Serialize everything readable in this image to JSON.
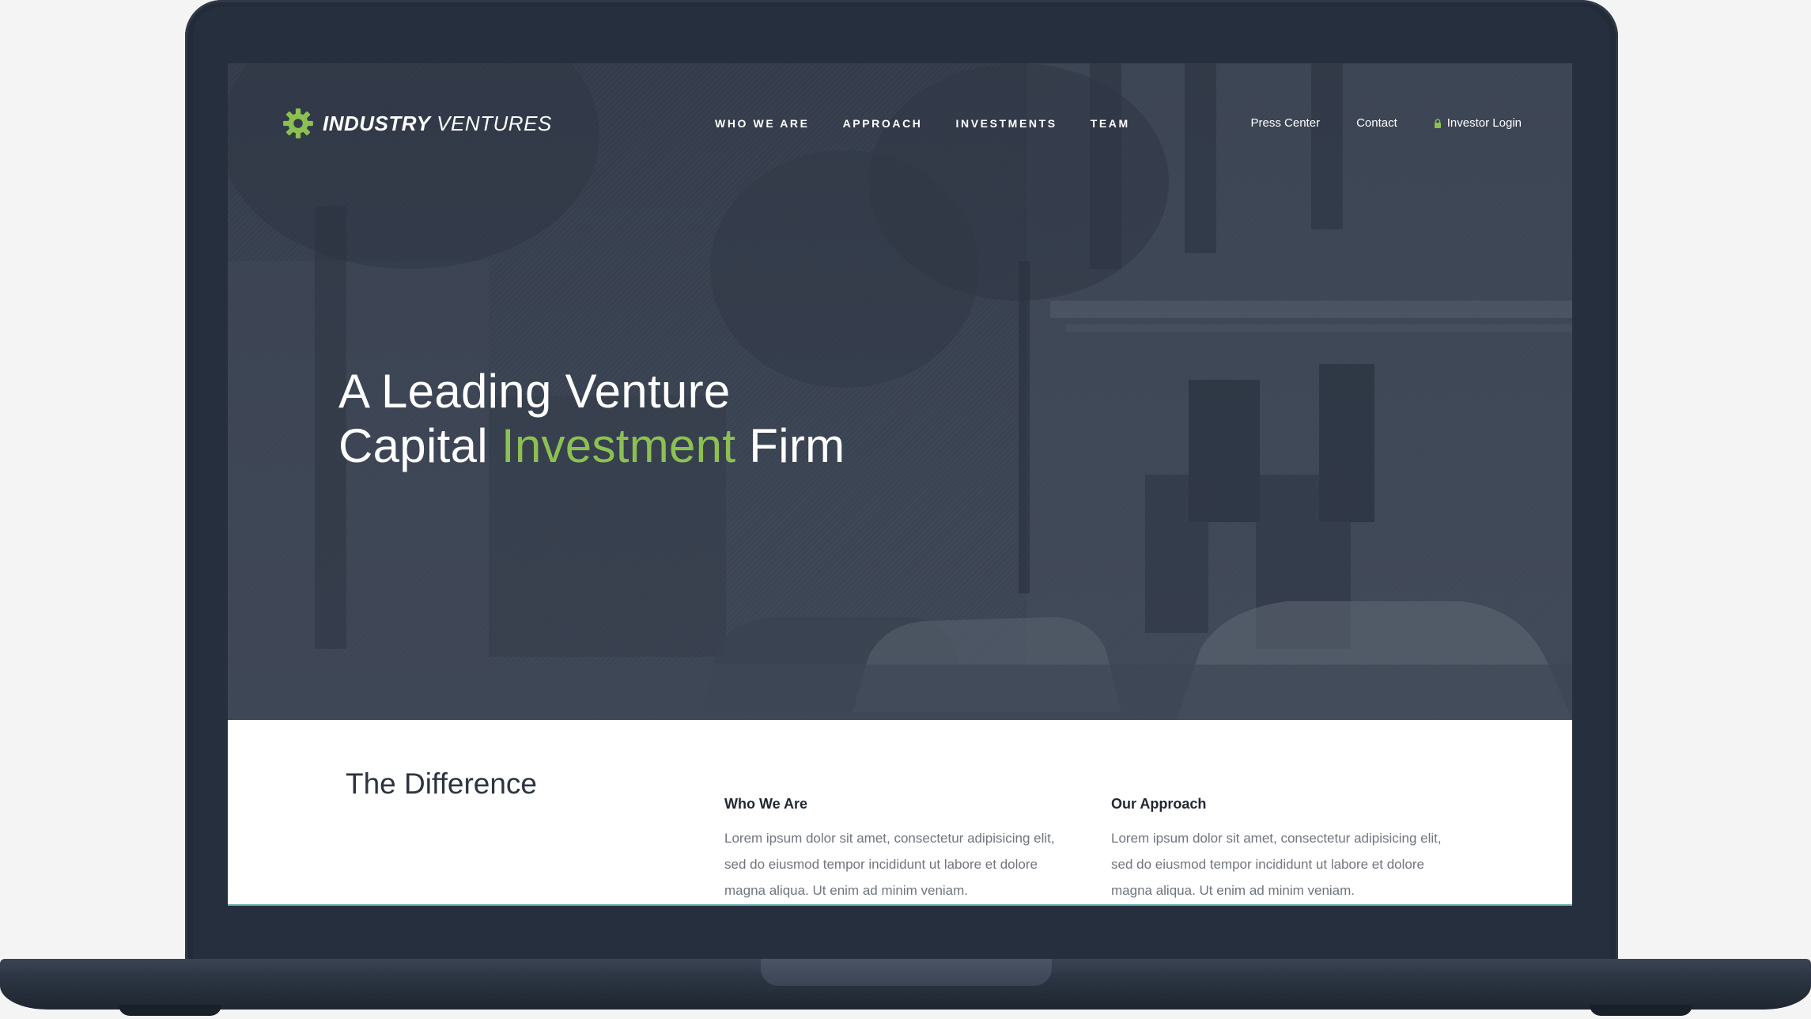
{
  "brand": {
    "name_strong": "INDUSTRY",
    "name_light": "VENTURES",
    "accent_color": "#8cc152",
    "background_color": "#343c4b"
  },
  "nav": {
    "main": [
      {
        "label": "WHO WE ARE"
      },
      {
        "label": "APPROACH"
      },
      {
        "label": "INVESTMENTS"
      },
      {
        "label": "TEAM"
      }
    ],
    "utility": {
      "press": "Press Center",
      "contact": "Contact",
      "login": "Investor Login"
    }
  },
  "hero": {
    "line1": "A Leading Venture",
    "line2_prefix": "Capital ",
    "line2_accent": "Investment",
    "line2_suffix": " Firm"
  },
  "difference": {
    "title": "The Difference",
    "columns": [
      {
        "heading": "Who We Are",
        "text": "Lorem ipsum dolor sit amet, consectetur adipisicing elit, sed do eiusmod tempor incididunt ut labore et dolore magna aliqua. Ut enim ad minim veniam."
      },
      {
        "heading": "Our Approach",
        "text": "Lorem ipsum dolor sit amet, consectetur adipisicing elit, sed do eiusmod tempor incididunt ut labore et dolore magna aliqua. Ut enim ad minim veniam."
      }
    ]
  }
}
